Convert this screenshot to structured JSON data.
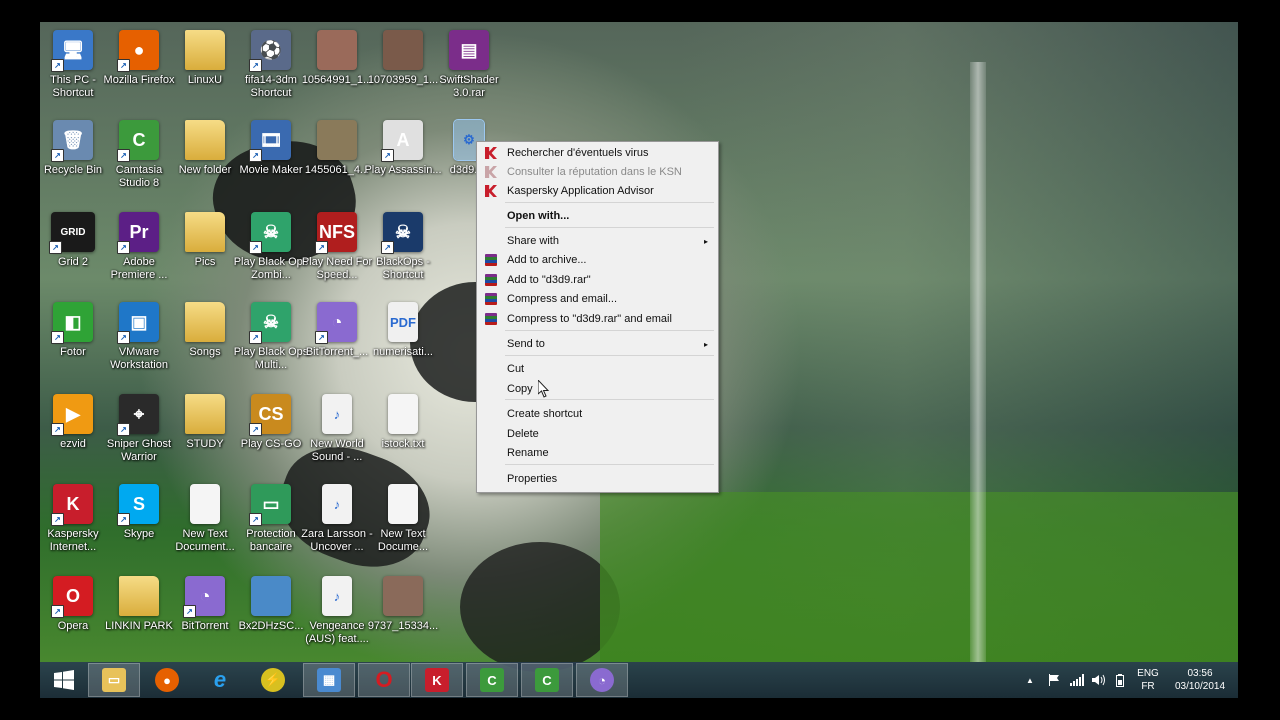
{
  "desktop": {
    "icons": [
      {
        "label": "This PC - Shortcut",
        "icon": "computer-icon",
        "color": "#3a78c8",
        "glyph": "🖥"
      },
      {
        "label": "Mozilla Firefox",
        "icon": "firefox-icon",
        "color": "#e66000",
        "glyph": "●"
      },
      {
        "label": "LinuxU",
        "icon": "folder-icon",
        "color": "#e8c25a",
        "glyph": ""
      },
      {
        "label": "fifa14-3dm Shortcut",
        "icon": "game-shortcut-icon",
        "color": "#5a6a8a",
        "glyph": "⚽"
      },
      {
        "label": "10564991_1...",
        "icon": "image-thumbnail-icon",
        "color": "#9a6a5a",
        "glyph": ""
      },
      {
        "label": "10703959_1...",
        "icon": "image-thumbnail-icon",
        "color": "#7a5a4a",
        "glyph": ""
      },
      {
        "label": "SwiftShader 3.0.rar",
        "icon": "rar-archive-icon",
        "color": "#7b2d8a",
        "glyph": "▤"
      },
      {
        "label": "Recycle Bin",
        "icon": "recycle-bin-icon",
        "color": "#6a8ab0",
        "glyph": "🗑"
      },
      {
        "label": "Camtasia Studio 8",
        "icon": "camtasia-icon",
        "color": "#3c9a3c",
        "glyph": "C"
      },
      {
        "label": "New folder",
        "icon": "folder-icon",
        "color": "#e8c25a",
        "glyph": ""
      },
      {
        "label": "Movie Maker",
        "icon": "movie-maker-icon",
        "color": "#3a6ab0",
        "glyph": "🎞"
      },
      {
        "label": "1455061_4...",
        "icon": "image-thumbnail-icon",
        "color": "#8a7a5a",
        "glyph": ""
      },
      {
        "label": "Play Assassin...",
        "icon": "assassins-creed-icon",
        "color": "#e0e0e0",
        "glyph": "A"
      },
      {
        "label": "d3d9.dll",
        "icon": "settings-file-icon",
        "color": "#cfd8e3",
        "glyph": "⚙"
      },
      {
        "label": "Grid 2",
        "icon": "grid2-game-icon",
        "color": "#1a1a1a",
        "glyph": "GRID"
      },
      {
        "label": "Adobe Premiere ...",
        "icon": "premiere-icon",
        "color": "#5c1f86",
        "glyph": "Pr"
      },
      {
        "label": "Pics",
        "icon": "folder-icon",
        "color": "#e8c25a",
        "glyph": ""
      },
      {
        "label": "Play Black Ops Zombi...",
        "icon": "black-ops-icon",
        "color": "#2fa36b",
        "glyph": "☠"
      },
      {
        "label": "Play Need For Speed...",
        "icon": "need-for-speed-icon",
        "color": "#b01e1e",
        "glyph": "NFS"
      },
      {
        "label": "BlackOps - Shortcut",
        "icon": "black-ops-icon",
        "color": "#1a3a6a",
        "glyph": "☠"
      },
      {
        "label": "Fotor",
        "icon": "fotor-icon",
        "color": "#2fa336",
        "glyph": "◧"
      },
      {
        "label": "VMware Workstation",
        "icon": "vmware-icon",
        "color": "#1f77c8",
        "glyph": "▣"
      },
      {
        "label": "Songs",
        "icon": "folder-icon",
        "color": "#e8c25a",
        "glyph": ""
      },
      {
        "label": "Play Black Ops Multi...",
        "icon": "black-ops-icon",
        "color": "#2fa36b",
        "glyph": "☠"
      },
      {
        "label": "BitTorrent_...",
        "icon": "bittorrent-icon",
        "color": "#8a6ad0",
        "glyph": "◔"
      },
      {
        "label": "numerisati...",
        "icon": "document-icon",
        "color": "#f0f0f0",
        "glyph": "PDF"
      },
      {
        "label": "ezvid",
        "icon": "ezvid-icon",
        "color": "#f09a12",
        "glyph": "▶"
      },
      {
        "label": "Sniper Ghost Warrior",
        "icon": "sniper-icon",
        "color": "#2a2a2a",
        "glyph": "⌖"
      },
      {
        "label": "STUDY",
        "icon": "folder-icon",
        "color": "#e8c25a",
        "glyph": ""
      },
      {
        "label": "Play CS-GO",
        "icon": "csgo-icon",
        "color": "#c98a1e",
        "glyph": "CS"
      },
      {
        "label": "New World Sound - ...",
        "icon": "mp3-file-icon",
        "color": "#f2f2f2",
        "glyph": "♪"
      },
      {
        "label": "istock.txt",
        "icon": "text-file-icon",
        "color": "#f5f5f5",
        "glyph": ""
      },
      {
        "label": "Kaspersky Internet...",
        "icon": "kaspersky-icon",
        "color": "#c81e2c",
        "glyph": "K"
      },
      {
        "label": "Skype",
        "icon": "skype-icon",
        "color": "#00a9f0",
        "glyph": "S"
      },
      {
        "label": "New Text Document...",
        "icon": "text-file-icon",
        "color": "#f5f5f5",
        "glyph": ""
      },
      {
        "label": "Protection bancaire",
        "icon": "safe-money-icon",
        "color": "#2f9a5a",
        "glyph": "▭"
      },
      {
        "label": "Zara Larsson - Uncover ...",
        "icon": "mp3-file-icon",
        "color": "#f2f2f2",
        "glyph": "♪"
      },
      {
        "label": "New Text Docume...",
        "icon": "text-file-icon",
        "color": "#f5f5f5",
        "glyph": ""
      },
      {
        "label": "Opera",
        "icon": "opera-icon",
        "color": "#d41c22",
        "glyph": "O"
      },
      {
        "label": "LINKIN PARK",
        "icon": "folder-icon",
        "color": "#e8c25a",
        "glyph": ""
      },
      {
        "label": "BitTorrent",
        "icon": "bittorrent-icon",
        "color": "#8a6ad0",
        "glyph": "◔"
      },
      {
        "label": "Bx2DHzSC...",
        "icon": "image-thumbnail-icon",
        "color": "#4a8ac8",
        "glyph": ""
      },
      {
        "label": "Vengeance (AUS) feat....",
        "icon": "mp3-file-icon",
        "color": "#f2f2f2",
        "glyph": "♪"
      },
      {
        "label": "9737_15334...",
        "icon": "image-thumbnail-icon",
        "color": "#8a6a5a",
        "glyph": ""
      }
    ]
  },
  "context_menu": {
    "items": [
      {
        "label": "Rechercher d'éventuels virus",
        "icon": "kaspersky",
        "disabled": false
      },
      {
        "label": "Consulter la réputation dans le KSN",
        "icon": "kaspersky",
        "disabled": true
      },
      {
        "label": "Kaspersky Application Advisor",
        "icon": "kaspersky",
        "disabled": false
      },
      {
        "label": "Open with...",
        "bold": true
      },
      {
        "label": "Share with",
        "submenu": true
      },
      {
        "label": "Add to archive...",
        "icon": "rar"
      },
      {
        "label": "Add to \"d3d9.rar\"",
        "icon": "rar"
      },
      {
        "label": "Compress and email...",
        "icon": "rar"
      },
      {
        "label": "Compress to \"d3d9.rar\" and email",
        "icon": "rar"
      },
      {
        "label": "Send to",
        "submenu": true
      },
      {
        "label": "Cut"
      },
      {
        "label": "Copy"
      },
      {
        "label": "Create shortcut"
      },
      {
        "label": "Delete"
      },
      {
        "label": "Rename"
      },
      {
        "label": "Properties"
      }
    ],
    "submenu_arrow": "▸"
  },
  "taskbar": {
    "language_top": "ENG",
    "language_bottom": "FR",
    "time": "03:56",
    "date": "03/10/2014",
    "show_hidden_icons": "▲"
  }
}
